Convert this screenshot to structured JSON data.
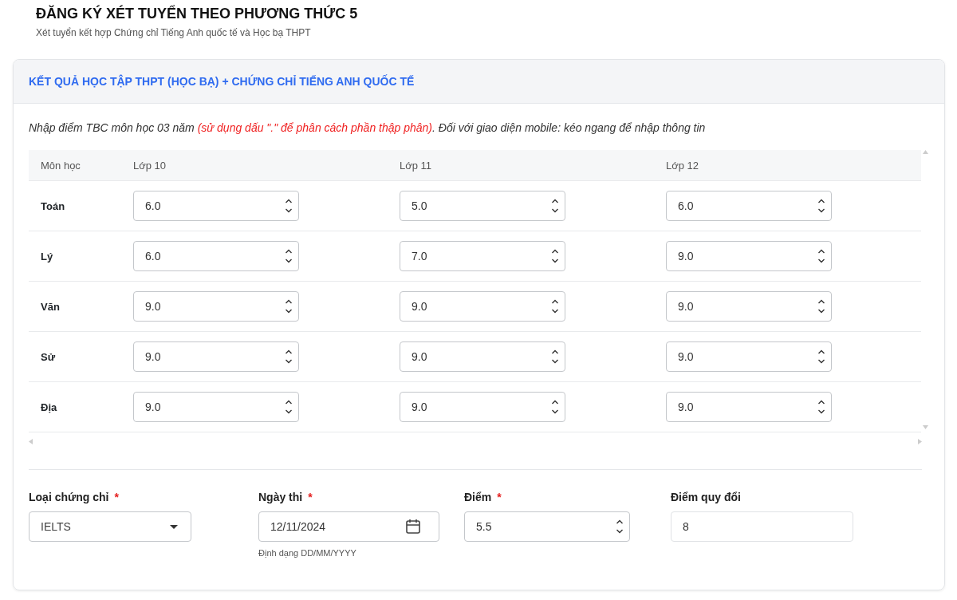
{
  "page": {
    "title": "ĐĂNG KÝ XÉT TUYỂN THEO PHƯƠNG THỨC 5",
    "subtitle": "Xét tuyển kết hợp Chứng chỉ Tiếng Anh quốc tế và Học bạ THPT"
  },
  "card": {
    "title": "KẾT QUẢ HỌC TẬP THPT (HỌC BẠ) + CHỨNG CHỈ TIẾNG ANH QUỐC TẾ",
    "instruction": [
      {
        "text": "Nhập điểm TBC môn học 03 năm ",
        "highlight": false
      },
      {
        "text": "(sử dụng dấu \".\" để phân cách phần thập phân)",
        "highlight": true
      },
      {
        "text": ". Đối với giao diện mobile: kéo ngang để nhập thông tin",
        "highlight": false
      }
    ],
    "table": {
      "columns": [
        "Môn học",
        "Lớp 10",
        "Lớp 11",
        "Lớp 12"
      ],
      "rows": [
        {
          "subject": "Toán",
          "scores": [
            "6.0",
            "5.0",
            "6.0"
          ]
        },
        {
          "subject": "Lý",
          "scores": [
            "6.0",
            "7.0",
            "9.0"
          ]
        },
        {
          "subject": "Văn",
          "scores": [
            "9.0",
            "9.0",
            "9.0"
          ]
        },
        {
          "subject": "Sử",
          "scores": [
            "9.0",
            "9.0",
            "9.0"
          ]
        },
        {
          "subject": "Địa",
          "scores": [
            "9.0",
            "9.0",
            "9.0"
          ]
        }
      ]
    },
    "required_mark": "*",
    "fields": [
      {
        "kind": "select",
        "label": "Loại chứng chỉ",
        "required": true,
        "value": "IELTS"
      },
      {
        "kind": "date",
        "label": "Ngày thi",
        "required": true,
        "value": "12/11/2024",
        "hint": "Định dạng DD/MM/YYYY"
      },
      {
        "kind": "number",
        "label": "Điểm",
        "required": true,
        "value": "5.5"
      },
      {
        "kind": "readonly",
        "label": "Điểm quy đổi",
        "required": false,
        "value": "8"
      }
    ]
  }
}
